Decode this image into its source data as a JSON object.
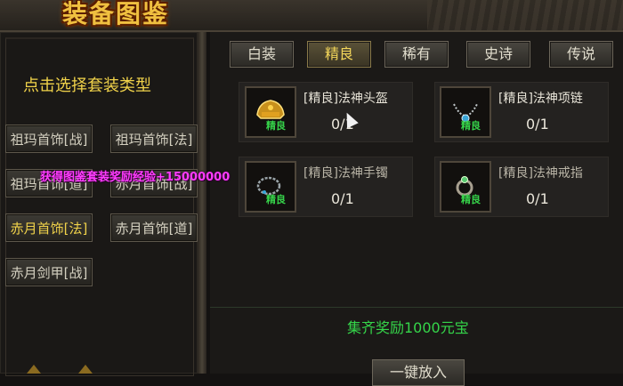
{
  "header": {
    "title": "装备图鉴"
  },
  "left": {
    "prompt": "点击选择套装类型",
    "suits": [
      {
        "label": "祖玛首饰[战]"
      },
      {
        "label": "祖玛首饰[法]"
      },
      {
        "label": "祖玛首饰[道]"
      },
      {
        "label": "赤月首饰[战]"
      },
      {
        "label": "赤月首饰[法]"
      },
      {
        "label": "赤月首饰[道]"
      },
      {
        "label": "赤月剑甲[战]"
      }
    ],
    "active_index": 4
  },
  "tabs": [
    {
      "label": "白装"
    },
    {
      "label": "精良"
    },
    {
      "label": "稀有"
    },
    {
      "label": "史诗"
    },
    {
      "label": "传说"
    }
  ],
  "active_tab": "精良",
  "items": [
    {
      "name": "[精良]法神头盔",
      "progress": "0/1",
      "grade": "精良",
      "icon": "helmet-icon"
    },
    {
      "name": "[精良]法神项链",
      "progress": "0/1",
      "grade": "精良",
      "icon": "necklace-icon"
    },
    {
      "name": "[精良]法神手镯",
      "progress": "0/1",
      "grade": "精良",
      "icon": "bracelet-icon"
    },
    {
      "name": "[精良]法神戒指",
      "progress": "0/1",
      "grade": "精良",
      "icon": "ring-icon"
    }
  ],
  "reward": "集齐奖励1000元宝",
  "button_one_key": "一键放入",
  "float_message": "获得图鉴套装奖励经验+15000000",
  "colors": {
    "accent_gold": "#f0d24a",
    "grade_green": "#36d34a",
    "float_magenta": "#ff3cff"
  }
}
